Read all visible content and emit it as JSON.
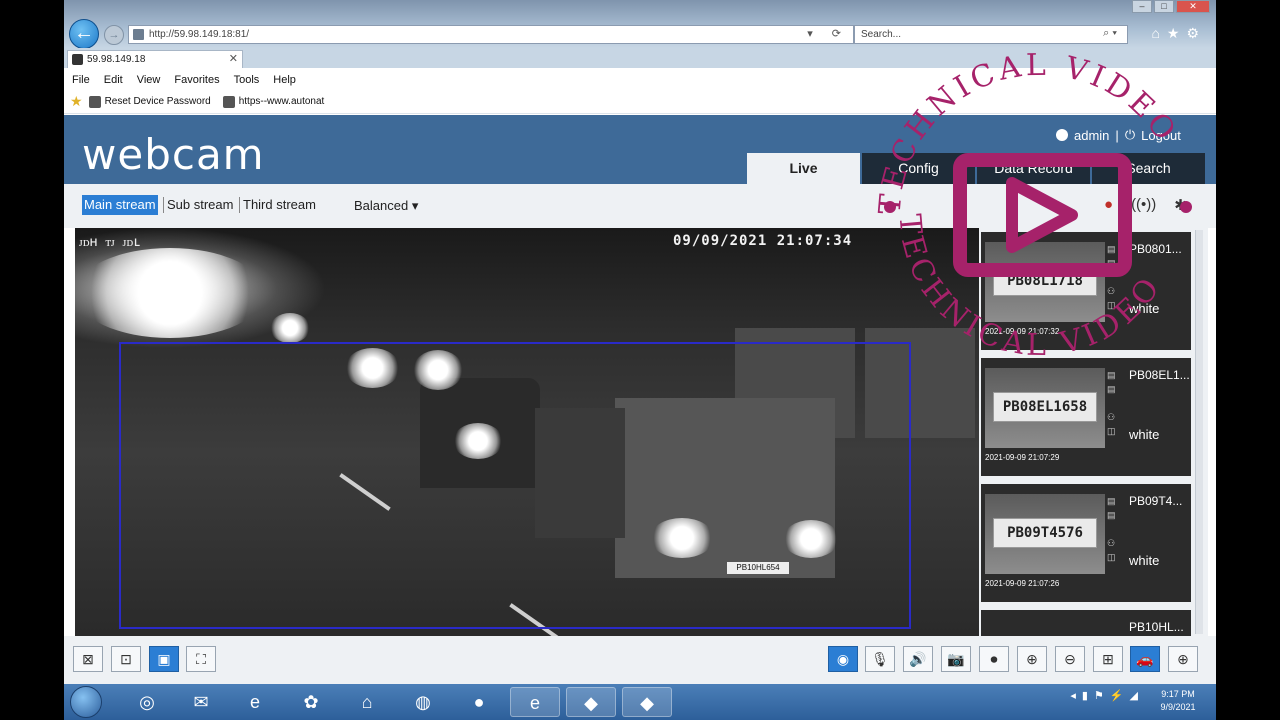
{
  "browser": {
    "address": "http://59.98.149.18:81/",
    "search_placeholder": "Search...",
    "tab_title": "59.98.149.18",
    "menu": [
      "File",
      "Edit",
      "View",
      "Favorites",
      "Tools",
      "Help"
    ],
    "favorites": [
      "Reset Device Password",
      "https--www.autonat"
    ]
  },
  "app": {
    "logo": "webcam",
    "user": "admin",
    "logout": "Logout",
    "nav_tabs": [
      "Live",
      "Config",
      "Data Record",
      "Search"
    ],
    "streams": [
      "Main stream",
      "Sub stream",
      "Third stream"
    ],
    "mode": "Balanced"
  },
  "video": {
    "label": "ᴊᴅʜ ᴛᴊ ᴊᴅʟ",
    "timestamp": "09/09/2021 21:07:34",
    "truck_plate": "PB10HL654"
  },
  "captures": [
    {
      "plate": "PB0801...",
      "plate_img": "PB08L1718",
      "color": "white",
      "time": "2021-09-09 21:07:32"
    },
    {
      "plate": "PB08EL1...",
      "plate_img": "PB08EL1658",
      "color": "white",
      "time": "2021-09-09 21:07:29"
    },
    {
      "plate": "PB09T4...",
      "plate_img": "PB09T4576",
      "color": "white",
      "time": "2021-09-09 21:07:26"
    },
    {
      "plate": "PB10HL...",
      "plate_img": "",
      "color": "",
      "time": ""
    }
  ],
  "taskbar": {
    "time": "9:17 PM",
    "date": "9/9/2021"
  },
  "watermark": {
    "text": "TECHNICAL VIDEO",
    "color": "#a6226a"
  },
  "colors": {
    "header": "#3e6a98",
    "active_tab": "#eef1f4",
    "accent": "#2b7ed4",
    "dark_tab": "#1e2b38"
  }
}
